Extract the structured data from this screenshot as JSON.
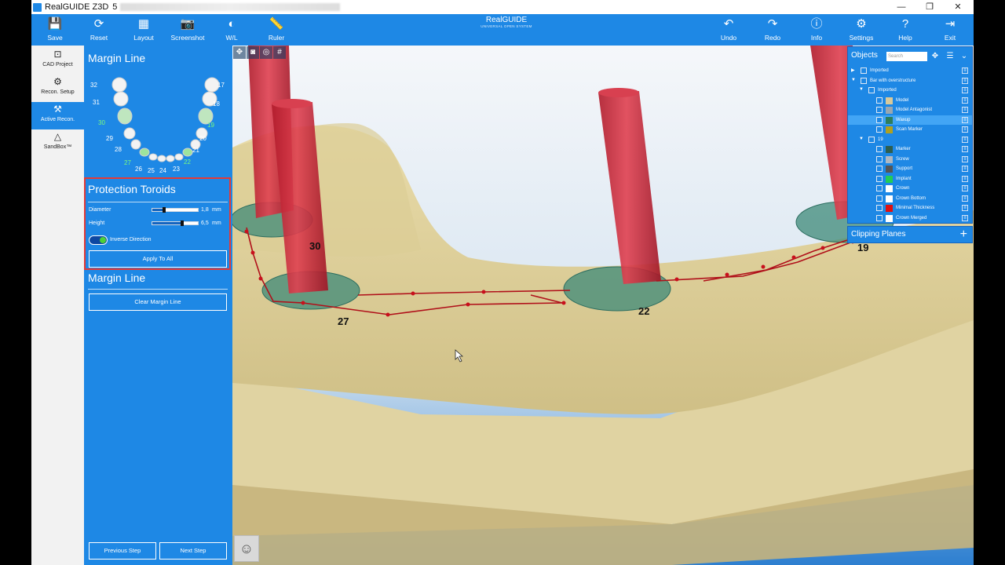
{
  "window": {
    "title": "RealGUIDE Z3D",
    "title_suffix": "5",
    "controls": [
      "—",
      "❐",
      "✕"
    ]
  },
  "brand": {
    "name": "RealGUIDE",
    "subtitle": "UNIVERSAL OPEN SYSTEM"
  },
  "toolbar": {
    "left": [
      {
        "label": "Save",
        "icon": "💾"
      },
      {
        "label": "Reset",
        "icon": "⟳"
      },
      {
        "label": "Layout",
        "icon": "▦"
      },
      {
        "label": "Screenshot",
        "icon": "📷"
      },
      {
        "label": "W/L",
        "icon": "◐"
      },
      {
        "label": "Ruler",
        "icon": "📏"
      }
    ],
    "right": [
      {
        "label": "Undo",
        "icon": "↶"
      },
      {
        "label": "Redo",
        "icon": "↷"
      },
      {
        "label": "Info",
        "icon": "ⓘ"
      },
      {
        "label": "Settings",
        "icon": "⚙"
      },
      {
        "label": "Help",
        "icon": "?"
      },
      {
        "label": "Exit",
        "icon": "⇥"
      }
    ]
  },
  "leftnav": [
    {
      "label": "CAD Project",
      "icon": "⊡",
      "active": false
    },
    {
      "label": "Recon. Setup",
      "icon": "⚙",
      "active": false
    },
    {
      "label": "Active Recon.",
      "icon": "⚒",
      "active": true
    },
    {
      "label": "SandBox™",
      "icon": "△",
      "active": false
    }
  ],
  "panel": {
    "margin_title": "Margin Line",
    "teeth": {
      "upper_left": [
        "32",
        "31",
        "30",
        "29",
        "28",
        "27",
        "26"
      ],
      "bottom": [
        "25",
        "24",
        "23"
      ],
      "right": [
        "17",
        "18",
        "19",
        "20",
        "21",
        "22"
      ]
    },
    "toroids": {
      "title": "Protection Toroids",
      "diameter": {
        "label": "Diameter",
        "value": "1,8",
        "unit": "mm",
        "fraction": 0.25
      },
      "height": {
        "label": "Height",
        "value": "6,5",
        "unit": "mm",
        "fraction": 0.62
      },
      "inverse_label": "Inverse Direction",
      "inverse_on": true,
      "apply_label": "Apply To All"
    },
    "margin2": {
      "title": "Margin Line",
      "clear_label": "Clear Margin Line"
    },
    "prev_label": "Previous Step",
    "next_label": "Next Step"
  },
  "viewport": {
    "labels": [
      "30",
      "27",
      "22",
      "19"
    ]
  },
  "objects": {
    "title": "Objects",
    "search_placeholder": "Search",
    "rows": [
      {
        "name": "Imported",
        "level": 0,
        "arrow": "▶",
        "swatch": null
      },
      {
        "name": "Bar with overstructure",
        "level": 0,
        "arrow": "▼",
        "swatch": null
      },
      {
        "name": "Imported",
        "level": 1,
        "arrow": "▼",
        "swatch": null
      },
      {
        "name": "Model",
        "level": 2,
        "swatch": "#d8c99a"
      },
      {
        "name": "Model Antagonist",
        "level": 2,
        "swatch": "#9aa7b0"
      },
      {
        "name": "Waxup",
        "level": 2,
        "swatch": "#2e7d5b",
        "selected": true
      },
      {
        "name": "Scan Marker",
        "level": 2,
        "swatch": "#b0a020"
      },
      {
        "name": "19",
        "level": 1,
        "arrow": "▼",
        "swatch": null
      },
      {
        "name": "Marker",
        "level": 2,
        "swatch": "#2e5e4e"
      },
      {
        "name": "Screw",
        "level": 2,
        "swatch": "#b0b8c0"
      },
      {
        "name": "Support",
        "level": 2,
        "swatch": "#555555"
      },
      {
        "name": "Implant",
        "level": 2,
        "swatch": "#22cc55"
      },
      {
        "name": "Crown",
        "level": 2,
        "swatch": "#ffffff"
      },
      {
        "name": "Crown Bottom",
        "level": 2,
        "swatch": "#ffffff"
      },
      {
        "name": "Minimal Thickness",
        "level": 2,
        "swatch": "#e01010"
      },
      {
        "name": "Crown Merged",
        "level": 2,
        "swatch": "#ffffff"
      }
    ]
  },
  "clipping": {
    "title": "Clipping Planes"
  }
}
